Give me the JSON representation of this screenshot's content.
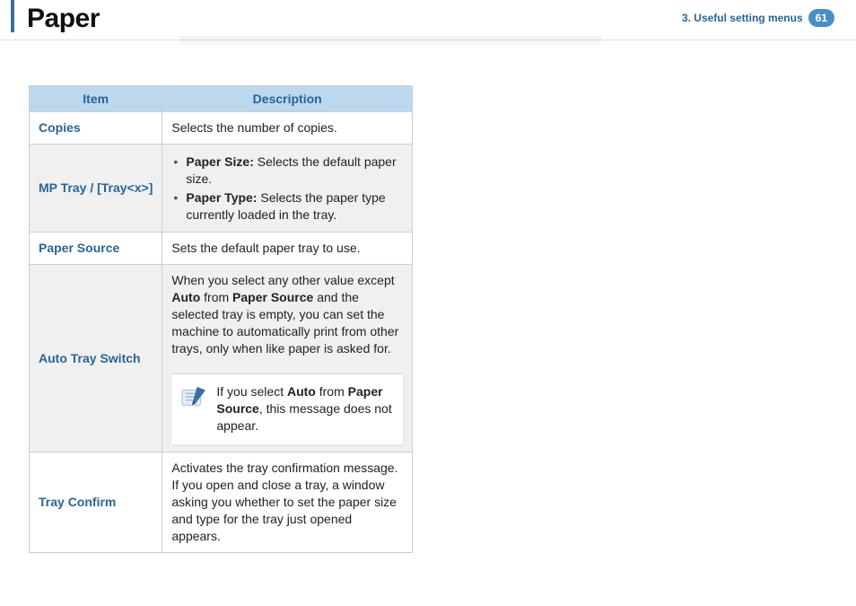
{
  "header": {
    "title": "Paper",
    "breadcrumb": "3.  Useful setting menus",
    "page_number": "61"
  },
  "table": {
    "headers": {
      "item": "Item",
      "description": "Description"
    },
    "rows": {
      "copies": {
        "item": "Copies",
        "desc": "Selects the number of copies."
      },
      "mptray": {
        "item": "MP Tray / [Tray<x>]",
        "bullet1_bold": "Paper Size:",
        "bullet1_rest": " Selects the default paper size.",
        "bullet2_bold": "Paper Type:",
        "bullet2_rest": " Selects the paper type currently loaded in the tray."
      },
      "papersource": {
        "item": "Paper Source",
        "desc": "Sets the default paper tray to use."
      },
      "autotray": {
        "item": "Auto Tray Switch",
        "p1a": "When you select any other value except ",
        "p1b": "Auto",
        "p1c": " from ",
        "p1d": "Paper Source",
        "p1e": " and the selected tray is empty, you can set the machine to automatically print from other trays, only when like paper is asked for.",
        "note_a": "If you select ",
        "note_b": "Auto",
        "note_c": " from ",
        "note_d": "Paper Source",
        "note_e": ", this message does not appear."
      },
      "trayconfirm": {
        "item": "Tray Confirm",
        "desc": "Activates the tray confirmation message. If you open and close a tray, a window asking you whether to set the paper size and type for the tray just opened appears."
      }
    }
  }
}
